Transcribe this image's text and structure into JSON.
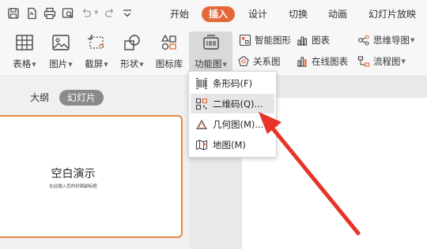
{
  "quick_access": {
    "icons": [
      "save-icon",
      "export-pdf-icon",
      "print-icon",
      "print-preview-icon",
      "undo-icon",
      "redo-icon",
      "customize-icon"
    ]
  },
  "menu_tabs": [
    "开始",
    "插入",
    "设计",
    "切换",
    "动画",
    "幻灯片放映"
  ],
  "active_tab": "插入",
  "ribbon": {
    "table": "表格",
    "picture": "图片",
    "screenshot": "截屏",
    "shapes": "形状",
    "icon_library": "图标库",
    "function_chart": "功能图",
    "smartart": "智能图形",
    "chart": "图表",
    "mindmap": "思维导图",
    "relationship": "关系图",
    "online_chart": "在线图表",
    "flowchart": "流程图"
  },
  "left_panel": {
    "tabs": [
      "大纲",
      "幻灯片"
    ],
    "active_tab": "幻灯片",
    "thumbnail": {
      "title": "空白演示",
      "subtitle": "在此输入您的封面副标题"
    }
  },
  "dropdown": {
    "items": [
      {
        "label": "条形码(F)",
        "icon": "barcode-icon"
      },
      {
        "label": "二维码(Q)...",
        "icon": "qrcode-icon"
      },
      {
        "label": "几何图(M)...",
        "icon": "geometry-icon"
      },
      {
        "label": "地图(M)",
        "icon": "map-icon"
      }
    ],
    "highlighted_index": 1
  },
  "colors": {
    "accent": "#e5683a",
    "arrow": "#e8332a",
    "thumbnail_border": "#e8883e"
  }
}
